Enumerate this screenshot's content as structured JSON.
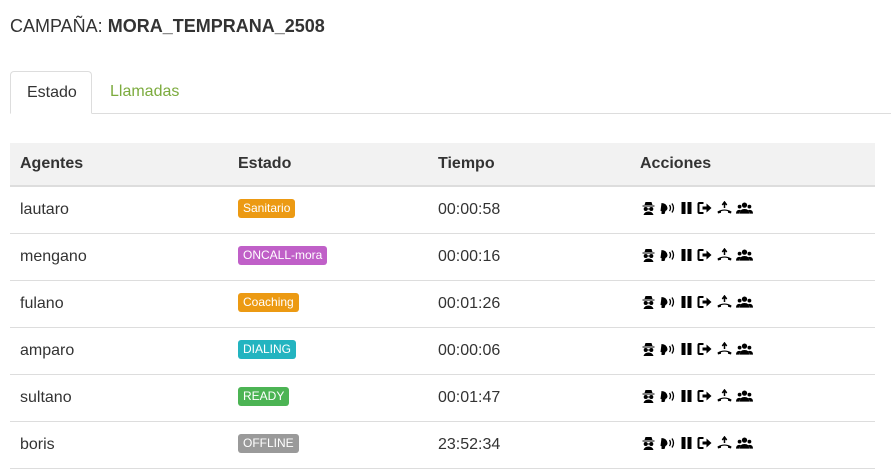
{
  "header": {
    "label": "CAMPAÑA:",
    "campaign_name": "MORA_TEMPRANA_2508"
  },
  "tabs": [
    {
      "label": "Estado",
      "active": true
    },
    {
      "label": "Llamadas",
      "active": false
    }
  ],
  "table": {
    "columns": [
      "Agentes",
      "Estado",
      "Tiempo",
      "Acciones"
    ],
    "rows": [
      {
        "agent": "lautaro",
        "state": "Sanitario",
        "state_color": "#ec9a13",
        "time": "00:00:58"
      },
      {
        "agent": "mengano",
        "state": "ONCALL-mora",
        "state_color": "#c060c8",
        "time": "00:00:16"
      },
      {
        "agent": "fulano",
        "state": "Coaching",
        "state_color": "#ec9a13",
        "time": "00:01:26"
      },
      {
        "agent": "amparo",
        "state": "DIALING",
        "state_color": "#23b4c0",
        "time": "00:00:06"
      },
      {
        "agent": "sultano",
        "state": "READY",
        "state_color": "#4cb454",
        "time": "00:01:47"
      },
      {
        "agent": "boris",
        "state": "OFFLINE",
        "state_color": "#9a9a9a",
        "time": "23:52:34"
      }
    ],
    "action_icons": [
      "spy-icon",
      "whisper-icon",
      "pause-icon",
      "logout-icon",
      "hangup-icon",
      "conference-icon"
    ]
  },
  "colors": {
    "tab_inactive": "#7cab3e",
    "header_bg": "#f2f2f2"
  }
}
